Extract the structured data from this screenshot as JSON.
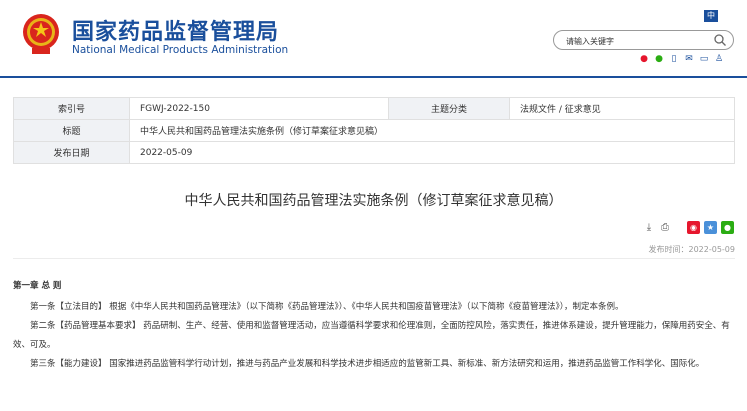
{
  "header": {
    "title_cn": "国家药品监督管理局",
    "title_en": "National Medical Products Administration",
    "lang_label": "中",
    "search_placeholder": "请输入关键字",
    "social_icons": [
      "weibo-icon",
      "wechat-icon",
      "mobile-icon",
      "mail-icon",
      "message-icon",
      "user-icon"
    ]
  },
  "meta": {
    "rows": [
      {
        "k1": "索引号",
        "v1": "FGWJ-2022-150",
        "k2": "主题分类",
        "v2": "法规文件 / 征求意见"
      },
      {
        "k1": "标题",
        "v1": "中华人民共和国药品管理法实施条例（修订草案征求意见稿）"
      },
      {
        "k1": "发布日期",
        "v1": "2022-05-09"
      }
    ]
  },
  "article": {
    "title": "中华人民共和国药品管理法实施条例（修订草案征求意见稿）",
    "publish_label": "发布时间：2022-05-09",
    "chapter": "第一章  总  则",
    "paragraphs": [
      "第一条【立法目的】  根据《中华人民共和国药品管理法》（以下简称《药品管理法》）、《中华人民共和国疫苗管理法》（以下简称《疫苗管理法》），制定本条例。",
      "第二条【药品管理基本要求】  药品研制、生产、经营、使用和监督管理活动，应当遵循科学要求和伦理准则，全面防控风险，落实责任，推进体系建设，提升管理能力，保障用药安全、有效、可及。",
      "第三条【能力建设】  国家推进药品监管科学行动计划，推进与药品产业发展和科学技术进步相适应的监管新工具、新标准、新方法研究和运用，推进药品监管工作科学化、国际化。"
    ]
  },
  "colors": {
    "brand": "#1a4f9c",
    "meta_key_bg": "#f0f2f5"
  }
}
